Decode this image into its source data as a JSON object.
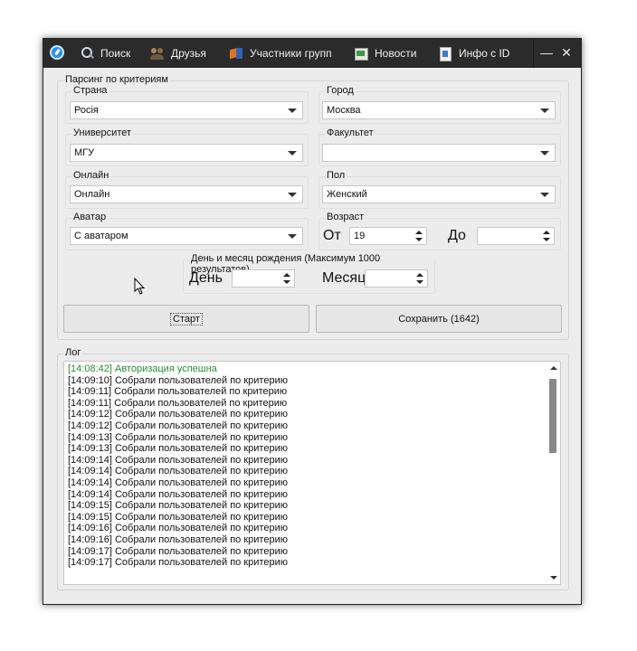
{
  "tabs": [
    {
      "label": "Поиск",
      "icon": "search-icon"
    },
    {
      "label": "Друзья",
      "icon": "friends-icon"
    },
    {
      "label": "Участники групп",
      "icon": "groups-icon"
    },
    {
      "label": "Новости",
      "icon": "news-icon"
    },
    {
      "label": "Инфо с ID",
      "icon": "info-icon"
    }
  ],
  "window_controls": {
    "minimize": "—",
    "close": "✕"
  },
  "parse_group": {
    "title": "Парсинг по критериям",
    "country": {
      "label": "Страна",
      "value": "Росія"
    },
    "city": {
      "label": "Город",
      "value": "Москва"
    },
    "university": {
      "label": "Университет",
      "value": "МГУ"
    },
    "faculty": {
      "label": "Факультет",
      "value": ""
    },
    "online": {
      "label": "Онлайн",
      "value": "Онлайн"
    },
    "sex": {
      "label": "Пол",
      "value": "Женский"
    },
    "avatar": {
      "label": "Аватар",
      "value": "С аватаром"
    },
    "age": {
      "label": "Возраст",
      "from_label": "От",
      "from_value": "19",
      "to_label": "До",
      "to_value": ""
    },
    "birthday": {
      "label": "День и месяц рождения (Максимум 1000 результатов)",
      "day_label": "День",
      "day_value": "",
      "month_label": "Месяц",
      "month_value": ""
    }
  },
  "buttons": {
    "start": "Старт",
    "save": "Сохранить (1642)"
  },
  "log": {
    "title": "Лог",
    "lines": [
      "[14:08:42] Авторизация успешна",
      "[14:09:10] Собрали пользователей по критерию",
      "[14:09:11] Собрали пользователей по критерию",
      "[14:09:11] Собрали пользователей по критерию",
      "[14:09:12] Собрали пользователей по критерию",
      "[14:09:12] Собрали пользователей по критерию",
      "[14:09:13] Собрали пользователей по критерию",
      "[14:09:13] Собрали пользователей по критерию",
      "[14:09:14] Собрали пользователей по критерию",
      "[14:09:14] Собрали пользователей по критерию",
      "[14:09:14] Собрали пользователей по критерию",
      "[14:09:14] Собрали пользователей по критерию",
      "[14:09:15] Собрали пользователей по критерию",
      "[14:09:15] Собрали пользователей по критерию",
      "[14:09:16] Собрали пользователей по критерию",
      "[14:09:16] Собрали пользователей по критерию",
      "[14:09:17] Собрали пользователей по критерию",
      "[14:09:17] Собрали пользователей по критерию"
    ]
  },
  "colors": {
    "titlebar": "#2b2b2b",
    "log_success": "#2e8b3a"
  }
}
